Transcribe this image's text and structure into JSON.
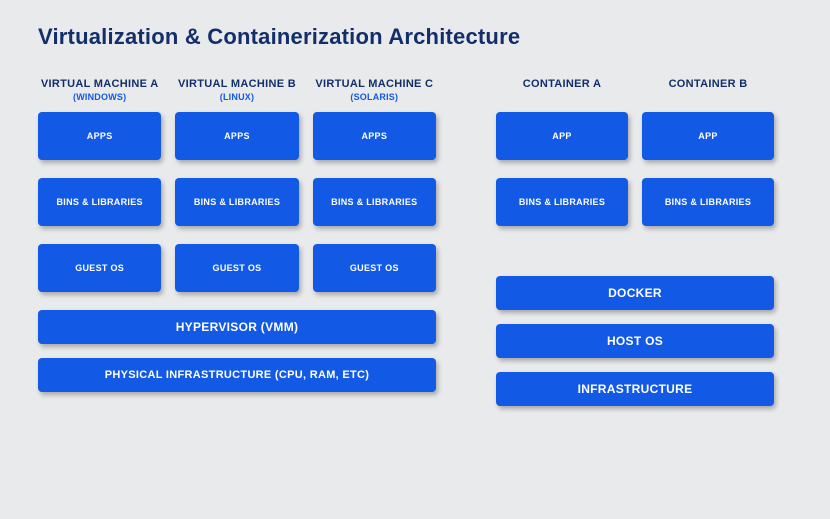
{
  "title": "Virtualization & Containerization Architecture",
  "vm": {
    "columns": [
      {
        "label": "VIRTUAL MACHINE A",
        "sub": "(WINDOWS)"
      },
      {
        "label": "VIRTUAL MACHINE B",
        "sub": "(LINUX)"
      },
      {
        "label": "VIRTUAL MACHINE C",
        "sub": "(SOLARIS)"
      }
    ],
    "rows": {
      "apps": [
        "APPS",
        "APPS",
        "APPS"
      ],
      "bins": [
        "BINS & LIBRARIES",
        "BINS & LIBRARIES",
        "BINS & LIBRARIES"
      ],
      "os": [
        "GUEST OS",
        "GUEST OS",
        "GUEST OS"
      ]
    },
    "hypervisor": "HYPERVISOR (VMM)",
    "infra": "PHYSICAL INFRASTRUCTURE (CPU, RAM, ETC)"
  },
  "ct": {
    "columns": [
      {
        "label": "CONTAINER A"
      },
      {
        "label": "CONTAINER B"
      }
    ],
    "rows": {
      "apps": [
        "APP",
        "APP"
      ],
      "bins": [
        "BINS & LIBRARIES",
        "BINS & LIBRARIES"
      ]
    },
    "docker": "DOCKER",
    "hostos": "HOST OS",
    "infra": "INFRASTRUCTURE"
  }
}
